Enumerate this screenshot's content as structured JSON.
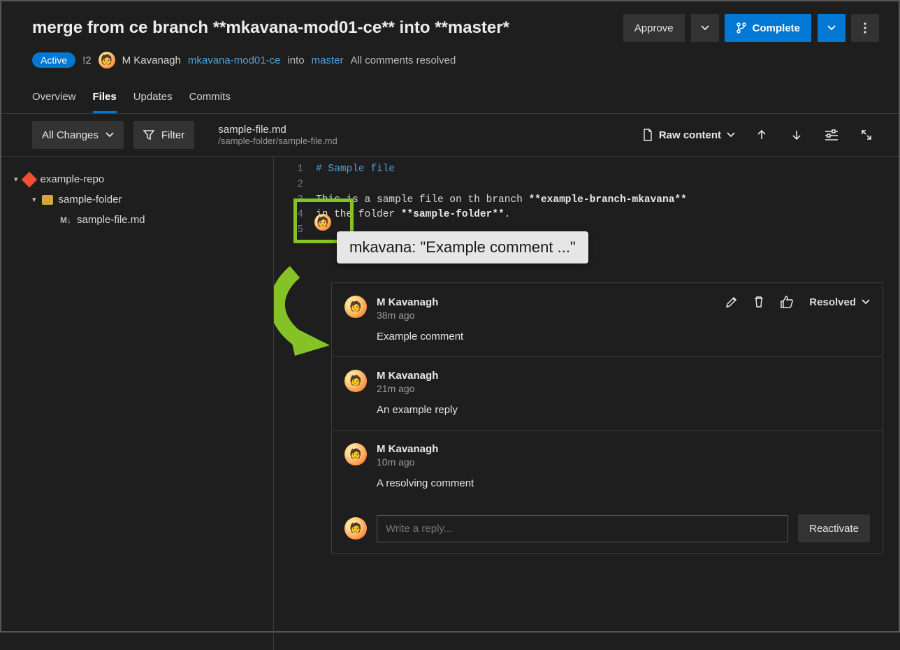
{
  "header": {
    "title": "merge from ce branch **mkavana-mod01-ce** into **master*",
    "approve": "Approve",
    "complete": "Complete",
    "status_badge": "Active",
    "pr_id": "!2",
    "author": "M Kavanagh",
    "source_branch": "mkavana-mod01-ce",
    "into": "into",
    "target_branch": "master",
    "comments_status": "All comments resolved"
  },
  "tabs": {
    "overview": "Overview",
    "files": "Files",
    "updates": "Updates",
    "commits": "Commits"
  },
  "toolbar": {
    "all_changes": "All Changes",
    "filter": "Filter",
    "filename": "sample-file.md",
    "filepath": "/sample-folder/sample-file.md",
    "raw_content": "Raw content"
  },
  "tree": {
    "repo": "example-repo",
    "folder": "sample-folder",
    "file": "sample-file.md"
  },
  "code": {
    "lines": [
      {
        "n": "1",
        "text": "# Sample file",
        "cls": "hdr"
      },
      {
        "n": "2",
        "text": ""
      },
      {
        "n": "3",
        "prefix": "This is a sample file on th branch ",
        "bold": "**example-branch-mkavana**"
      },
      {
        "n": "4",
        "prefix": "in the folder ",
        "bold": "**sample-folder**",
        "suffix": "."
      },
      {
        "n": "5",
        "text": ""
      }
    ]
  },
  "tooltip": "mkavana: \"Example comment ...\"",
  "thread": {
    "comments": [
      {
        "author": "M Kavanagh",
        "time": "38m ago",
        "text": "Example comment",
        "status": "Resolved"
      },
      {
        "author": "M Kavanagh",
        "time": "21m ago",
        "text": "An example reply"
      },
      {
        "author": "M Kavanagh",
        "time": "10m ago",
        "text": "A resolving comment"
      }
    ],
    "reply_placeholder": "Write a reply...",
    "reactivate": "Reactivate"
  }
}
